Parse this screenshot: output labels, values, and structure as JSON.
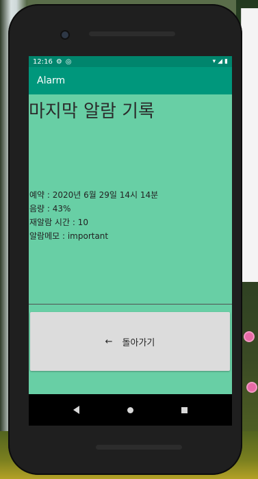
{
  "status_bar": {
    "time": "12:16",
    "icons_left": [
      "gear-icon",
      "sync-icon"
    ],
    "icons_right": [
      "wifi-icon",
      "signal-icon",
      "battery-icon"
    ]
  },
  "app_bar": {
    "title": "Alarm"
  },
  "screen": {
    "heading": "마지막 알람 기록",
    "details": [
      "예약 : 2020년 6월 29일 14시 14분",
      "음량 : 43%",
      "재알람 시간 : 10",
      "알람메모 : important"
    ],
    "back_button": {
      "arrow": "←",
      "label": "돌아가기"
    }
  },
  "colors": {
    "screen_bg": "#68cfa5",
    "status_bar": "#00856d",
    "app_bar": "#00977c",
    "button_bg": "#dcdcdc"
  }
}
